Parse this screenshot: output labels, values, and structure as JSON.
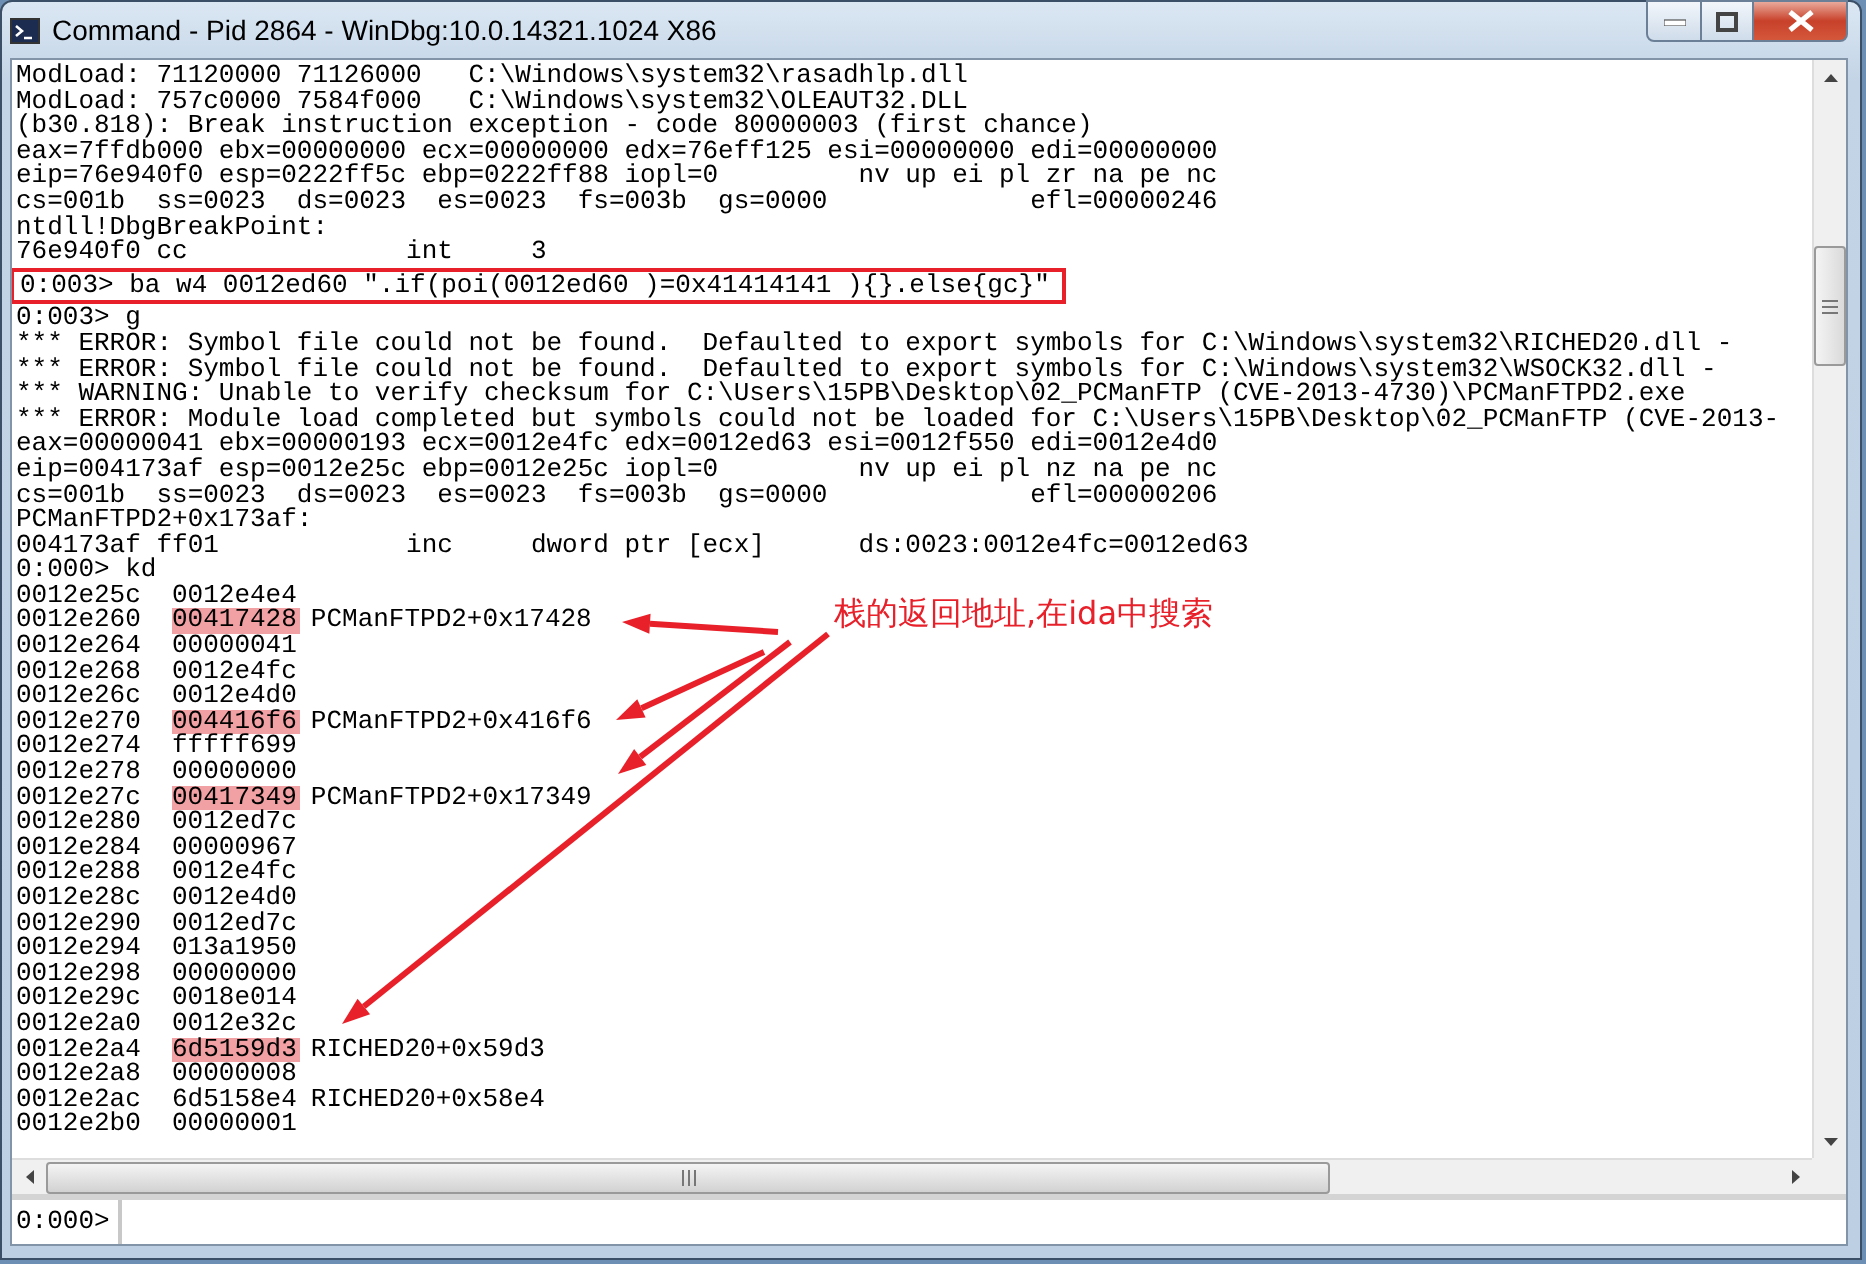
{
  "window": {
    "title": "Command - Pid 2864 - WinDbg:10.0.14321.1024 X86"
  },
  "output": [
    {
      "kind": "text",
      "text": "ModLoad: 71120000 71126000   C:\\Windows\\system32\\rasadhlp.dll"
    },
    {
      "kind": "text",
      "text": "ModLoad: 757c0000 7584f000   C:\\Windows\\system32\\OLEAUT32.DLL"
    },
    {
      "kind": "text",
      "text": "(b30.818): Break instruction exception - code 80000003 (first chance)"
    },
    {
      "kind": "text",
      "text": "eax=7ffdb000 ebx=00000000 ecx=00000000 edx=76eff125 esi=00000000 edi=00000000"
    },
    {
      "kind": "text",
      "text": "eip=76e940f0 esp=0222ff5c ebp=0222ff88 iopl=0         nv up ei pl zr na pe nc"
    },
    {
      "kind": "text",
      "text": "cs=001b  ss=0023  ds=0023  es=0023  fs=003b  gs=0000             efl=00000246"
    },
    {
      "kind": "text",
      "text": "ntdll!DbgBreakPoint:"
    },
    {
      "kind": "text",
      "text": "76e940f0 cc              int     3"
    },
    {
      "kind": "boxed",
      "text": "0:003> ba w4 0012ed60 \".if(poi(0012ed60 )=0x41414141 ){}.else{gc}\""
    },
    {
      "kind": "text",
      "text": "0:003> g"
    },
    {
      "kind": "text",
      "text": "*** ERROR: Symbol file could not be found.  Defaulted to export symbols for C:\\Windows\\system32\\RICHED20.dll -"
    },
    {
      "kind": "text",
      "text": "*** ERROR: Symbol file could not be found.  Defaulted to export symbols for C:\\Windows\\system32\\WSOCK32.dll -"
    },
    {
      "kind": "text",
      "text": "*** WARNING: Unable to verify checksum for C:\\Users\\15PB\\Desktop\\02_PCManFTP (CVE-2013-4730)\\PCManFTPD2.exe"
    },
    {
      "kind": "text",
      "text": "*** ERROR: Module load completed but symbols could not be loaded for C:\\Users\\15PB\\Desktop\\02_PCManFTP (CVE-2013-"
    },
    {
      "kind": "text",
      "text": "eax=00000041 ebx=00000193 ecx=0012e4fc edx=0012ed63 esi=0012f550 edi=0012e4d0"
    },
    {
      "kind": "text",
      "text": "eip=004173af esp=0012e25c ebp=0012e25c iopl=0         nv up ei pl nz na pe nc"
    },
    {
      "kind": "text",
      "text": "cs=001b  ss=0023  ds=0023  es=0023  fs=003b  gs=0000             efl=00000206"
    },
    {
      "kind": "text",
      "text": "PCManFTPD2+0x173af:"
    },
    {
      "kind": "text",
      "text": "004173af ff01            inc     dword ptr [ecx]      ds:0023:0012e4fc=0012ed63"
    },
    {
      "kind": "text",
      "text": "0:000> kd"
    },
    {
      "kind": "stack",
      "address": "0012e25c",
      "value": "0012e4e4",
      "highlighted": false
    },
    {
      "kind": "stack",
      "address": "0012e260",
      "value": "00417428",
      "symbol": "PCManFTPD2+0x17428",
      "highlighted": true
    },
    {
      "kind": "stack",
      "address": "0012e264",
      "value": "00000041",
      "highlighted": false
    },
    {
      "kind": "stack",
      "address": "0012e268",
      "value": "0012e4fc",
      "highlighted": false
    },
    {
      "kind": "stack",
      "address": "0012e26c",
      "value": "0012e4d0",
      "highlighted": false
    },
    {
      "kind": "stack",
      "address": "0012e270",
      "value": "004416f6",
      "symbol": "PCManFTPD2+0x416f6",
      "highlighted": true
    },
    {
      "kind": "stack",
      "address": "0012e274",
      "value": "fffff699",
      "highlighted": false
    },
    {
      "kind": "stack",
      "address": "0012e278",
      "value": "00000000",
      "highlighted": false
    },
    {
      "kind": "stack",
      "address": "0012e27c",
      "value": "00417349",
      "symbol": "PCManFTPD2+0x17349",
      "highlighted": true
    },
    {
      "kind": "stack",
      "address": "0012e280",
      "value": "0012ed7c",
      "highlighted": false
    },
    {
      "kind": "stack",
      "address": "0012e284",
      "value": "00000967",
      "highlighted": false
    },
    {
      "kind": "stack",
      "address": "0012e288",
      "value": "0012e4fc",
      "highlighted": false
    },
    {
      "kind": "stack",
      "address": "0012e28c",
      "value": "0012e4d0",
      "highlighted": false
    },
    {
      "kind": "stack",
      "address": "0012e290",
      "value": "0012ed7c",
      "highlighted": false
    },
    {
      "kind": "stack",
      "address": "0012e294",
      "value": "013a1950",
      "highlighted": false
    },
    {
      "kind": "stack",
      "address": "0012e298",
      "value": "00000000",
      "highlighted": false
    },
    {
      "kind": "stack",
      "address": "0012e29c",
      "value": "0018e014",
      "highlighted": false
    },
    {
      "kind": "stack",
      "address": "0012e2a0",
      "value": "0012e32c",
      "highlighted": false
    },
    {
      "kind": "stack",
      "address": "0012e2a4",
      "value": "6d5159d3",
      "symbol": "RICHED20+0x59d3",
      "highlighted": true
    },
    {
      "kind": "stack",
      "address": "0012e2a8",
      "value": "00000008",
      "highlighted": false
    },
    {
      "kind": "stack",
      "address": "0012e2ac",
      "value": "6d5158e4",
      "symbol": "RICHED20+0x58e4",
      "highlighted": false
    },
    {
      "kind": "stack",
      "address": "0012e2b0",
      "value": "00000001",
      "highlighted": false
    }
  ],
  "annotation": {
    "text": "栈的返回地址,在ida中搜索"
  },
  "prompt": {
    "label": "0:000>"
  }
}
